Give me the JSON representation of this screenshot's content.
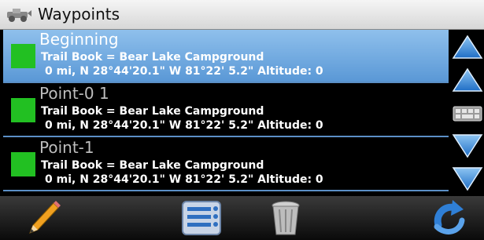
{
  "window": {
    "title": "Waypoints"
  },
  "waypoints": [
    {
      "name": "Beginning",
      "trail_book": "Trail Book = Bear Lake Campground",
      "location": "0 mi, N 28°44'20.1\"  W 81°22' 5.2\" Altitude: 0",
      "color": "#22c022",
      "selected": true
    },
    {
      "name": "Point-0 1",
      "trail_book": "Trail Book = Bear Lake Campground",
      "location": "0 mi, N 28°44'20.1\"  W 81°22' 5.2\" Altitude: 0",
      "color": "#22c022",
      "selected": false
    },
    {
      "name": "Point-1",
      "trail_book": "Trail Book = Bear Lake Campground",
      "location": "0 mi, N 28°44'20.1\"  W 81°22' 5.2\" Altitude: 0",
      "color": "#22c022",
      "selected": false
    }
  ],
  "scrollbar": {
    "icons": [
      "scroll-top-icon",
      "scroll-up-icon",
      "keyboard-icon",
      "scroll-down-icon",
      "scroll-bottom-icon"
    ]
  },
  "toolbar": {
    "icons": [
      "pencil-icon",
      "list-menu-icon",
      "trash-icon",
      "back-icon"
    ]
  },
  "colors": {
    "accent_blue": "#2f7fd6",
    "selected_row": "#6aa6de",
    "waypoint_green": "#22c022"
  }
}
